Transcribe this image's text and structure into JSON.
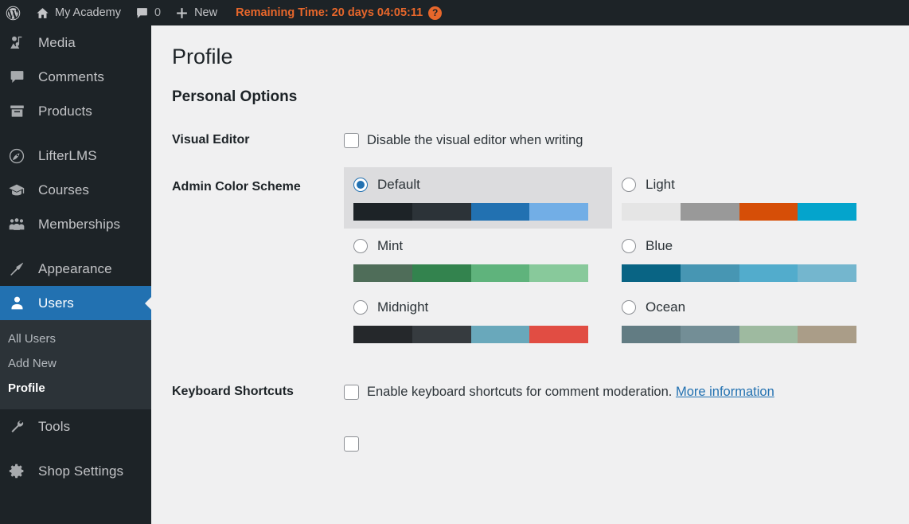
{
  "adminbar": {
    "wp_logo_name": "wordpress-logo-icon",
    "site_name": "My Academy",
    "comment_count": "0",
    "new_label": "New",
    "timer_text": "Remaining Time: 20 days 04:05:11",
    "help_badge": "?",
    "timer_color": "#e8672b"
  },
  "sidebar": {
    "highlight_color": "#2271b1",
    "background": "#1d2327",
    "items": [
      {
        "label": "Media",
        "icon": "media-icon",
        "current": false
      },
      {
        "label": "Comments",
        "icon": "comments-icon",
        "current": false
      },
      {
        "label": "Products",
        "icon": "products-icon",
        "current": false
      },
      {
        "label": "LifterLMS",
        "icon": "lifterlms-icon",
        "current": false
      },
      {
        "label": "Courses",
        "icon": "courses-icon",
        "current": false
      },
      {
        "label": "Memberships",
        "icon": "memberships-icon",
        "current": false
      },
      {
        "label": "Appearance",
        "icon": "appearance-icon",
        "current": false
      },
      {
        "label": "Users",
        "icon": "users-icon",
        "current": true
      },
      {
        "label": "Tools",
        "icon": "tools-icon",
        "current": false
      },
      {
        "label": "Shop Settings",
        "icon": "gear-icon",
        "current": false
      }
    ],
    "submenu": [
      {
        "label": "All Users",
        "current": false
      },
      {
        "label": "Add New",
        "current": false
      },
      {
        "label": "Profile",
        "current": true
      }
    ]
  },
  "main": {
    "page_title": "Profile",
    "section_title": "Personal Options",
    "rows": {
      "visual_editor": {
        "label": "Visual Editor",
        "checkbox_label": "Disable the visual editor when writing",
        "checked": false
      },
      "admin_color_scheme": {
        "label": "Admin Color Scheme"
      },
      "keyboard_shortcuts": {
        "label": "Keyboard Shortcuts",
        "checkbox_label": "Enable keyboard shortcuts for comment moderation.",
        "more_link": "More information",
        "checked": false
      }
    },
    "color_schemes": [
      {
        "name": "Default",
        "selected": true,
        "colors": [
          "#1d2327",
          "#2c3338",
          "#2271b1",
          "#72aee6"
        ]
      },
      {
        "name": "Light",
        "selected": false,
        "colors": [
          "#e5e5e5",
          "#999999",
          "#d64e07",
          "#04a4cc"
        ]
      },
      {
        "name": "Mint",
        "selected": false,
        "colors": [
          "#4f6d59",
          "#33834e",
          "#5fb37c",
          "#88c99b"
        ]
      },
      {
        "name": "Blue",
        "selected": false,
        "colors": [
          "#096484",
          "#4796b3",
          "#52accc",
          "#74b6ce"
        ]
      },
      {
        "name": "Midnight",
        "selected": false,
        "colors": [
          "#25282b",
          "#363b3f",
          "#69a8bb",
          "#e14d43"
        ]
      },
      {
        "name": "Ocean",
        "selected": false,
        "colors": [
          "#627c83",
          "#738e96",
          "#9ebaa0",
          "#aa9d88"
        ]
      }
    ]
  }
}
